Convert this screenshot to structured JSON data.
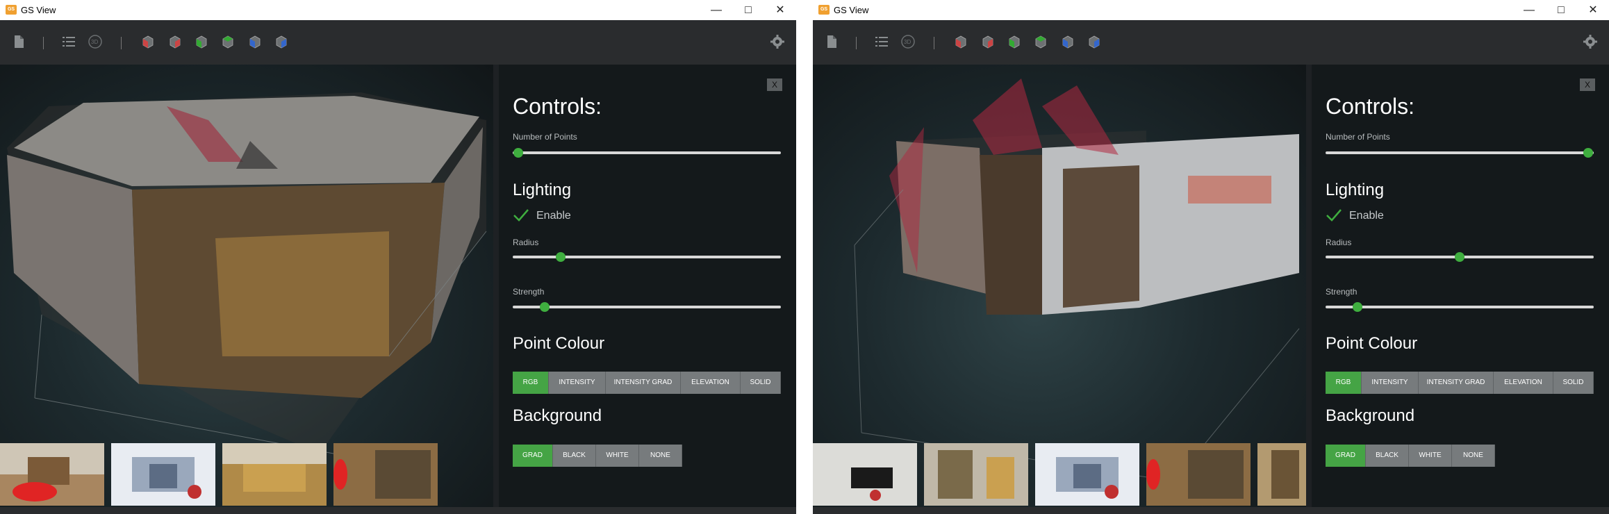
{
  "windows": [
    {
      "id": "left",
      "title": "GS View",
      "app_icon": "GS",
      "panel": {
        "close": "X",
        "heading": "Controls:",
        "points_label": "Number of Points",
        "points_value": 0.02,
        "lighting_heading": "Lighting",
        "enable_label": "Enable",
        "enable_checked": true,
        "radius_label": "Radius",
        "radius_value": 0.18,
        "strength_label": "Strength",
        "strength_value": 0.12,
        "colour_heading": "Point Colour",
        "colour_options": [
          "RGB",
          "INTENSITY",
          "INTENSITY GRAD",
          "ELEVATION",
          "SOLID"
        ],
        "colour_selected": "RGB",
        "background_heading": "Background",
        "background_options": [
          "GRAD",
          "BLACK",
          "WHITE",
          "NONE"
        ],
        "background_selected": "GRAD"
      }
    },
    {
      "id": "right",
      "title": "GS View",
      "app_icon": "GS",
      "panel": {
        "close": "X",
        "heading": "Controls:",
        "points_label": "Number of Points",
        "points_value": 0.98,
        "lighting_heading": "Lighting",
        "enable_label": "Enable",
        "enable_checked": true,
        "radius_label": "Radius",
        "radius_value": 0.5,
        "strength_label": "Strength",
        "strength_value": 0.12,
        "colour_heading": "Point Colour",
        "colour_options": [
          "RGB",
          "INTENSITY",
          "INTENSITY GRAD",
          "ELEVATION",
          "SOLID"
        ],
        "colour_selected": "RGB",
        "background_heading": "Background",
        "background_options": [
          "GRAD",
          "BLACK",
          "WHITE",
          "NONE"
        ],
        "background_selected": "GRAD"
      }
    }
  ],
  "toolbar_icons": [
    "file-icon",
    "list-icon",
    "rotate-3d-icon",
    "view-cube-icon",
    "view-cube-red-icon",
    "view-cube-green-icon",
    "view-cube-green-alt-icon",
    "view-cube-blue-icon",
    "view-cube-blue-alt-icon",
    "settings-gear-icon"
  ],
  "colors": {
    "accent_green": "#45a445",
    "panel_bg": "#14191b",
    "button_grey": "#777b7d"
  }
}
